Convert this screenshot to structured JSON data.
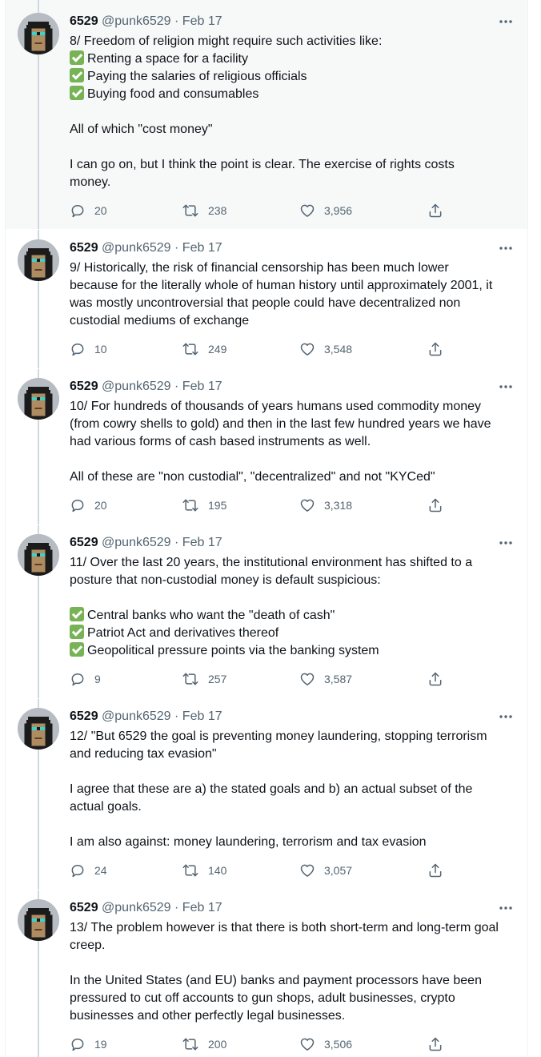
{
  "tweets": [
    {
      "name": "6529",
      "handle": "@punk6529",
      "separator": "·",
      "date": "Feb 17",
      "lines": [
        {
          "text": "8/ Freedom of religion might require such activities like:"
        },
        {
          "check": true,
          "text": "Renting a space for a facility"
        },
        {
          "check": true,
          "text": "Paying the salaries of religious officials"
        },
        {
          "check": true,
          "text": "Buying food and consumables"
        },
        {
          "gap": true
        },
        {
          "text": "All of which \"cost money\""
        },
        {
          "gap": true
        },
        {
          "text": "I can go on, but I think the point is clear.   The exercise of rights costs"
        },
        {
          "text": "money."
        }
      ],
      "replies": "20",
      "retweets": "238",
      "likes": "3,956"
    },
    {
      "name": "6529",
      "handle": "@punk6529",
      "separator": "·",
      "date": "Feb 17",
      "lines": [
        {
          "text": "9/ Historically, the risk of financial censorship has been much lower"
        },
        {
          "text": "because for the literally whole of human history until approximately 2001, it"
        },
        {
          "text": "was mostly uncontroversial that people could have decentralized non"
        },
        {
          "text": "custodial mediums of exchange"
        }
      ],
      "replies": "10",
      "retweets": "249",
      "likes": "3,548"
    },
    {
      "name": "6529",
      "handle": "@punk6529",
      "separator": "·",
      "date": "Feb 17",
      "lines": [
        {
          "text": "10/ For hundreds of thousands of years humans used commodity money"
        },
        {
          "text": "(from cowry shells to gold) and then in the last few hundred years we have"
        },
        {
          "text": "had various forms of cash based instruments as well."
        },
        {
          "gap": true
        },
        {
          "text": "All of these are \"non custodial\", \"decentralized\" and not \"KYCed\""
        }
      ],
      "replies": "20",
      "retweets": "195",
      "likes": "3,318"
    },
    {
      "name": "6529",
      "handle": "@punk6529",
      "separator": "·",
      "date": "Feb 17",
      "lines": [
        {
          "text": "11/ Over the last 20 years, the institutional environment has shifted to a"
        },
        {
          "text": "posture that non-custodial money is default suspicious:"
        },
        {
          "gap": true
        },
        {
          "check": true,
          "text": "Central banks who want the \"death of cash\""
        },
        {
          "check": true,
          "text": "Patriot Act and derivatives thereof"
        },
        {
          "check": true,
          "text": "Geopolitical pressure points via the banking system"
        }
      ],
      "replies": "9",
      "retweets": "257",
      "likes": "3,587"
    },
    {
      "name": "6529",
      "handle": "@punk6529",
      "separator": "·",
      "date": "Feb 17",
      "lines": [
        {
          "text": "12/ \"But 6529 the goal is preventing money laundering, stopping terrorism"
        },
        {
          "text": "and reducing tax evasion\""
        },
        {
          "gap": true
        },
        {
          "text": "I agree that these are a) the stated goals and b) an actual subset of the"
        },
        {
          "text": "actual goals."
        },
        {
          "gap": true
        },
        {
          "text": "I am also against: money laundering, terrorism and tax evasion"
        }
      ],
      "replies": "24",
      "retweets": "140",
      "likes": "3,057"
    },
    {
      "name": "6529",
      "handle": "@punk6529",
      "separator": "·",
      "date": "Feb 17",
      "lines": [
        {
          "text": "13/ The problem however is that there is both short-term and long-term goal"
        },
        {
          "text": "creep."
        },
        {
          "gap": true
        },
        {
          "text": "In the United States (and EU) banks and payment processors have been"
        },
        {
          "text": "pressured to cut off accounts to gun shops, adult businesses, crypto"
        },
        {
          "text": "businesses and other perfectly legal businesses."
        }
      ],
      "replies": "19",
      "retweets": "200",
      "likes": "3,506"
    }
  ],
  "icons": {
    "more": "more-icon",
    "reply": "reply-icon",
    "retweet": "retweet-icon",
    "like": "like-icon",
    "share": "share-icon"
  },
  "colors": {
    "text": "#0f1419",
    "secondary": "#536471",
    "check_green": "#77b255",
    "thread_line": "#cfd9de",
    "highlight_bg": "#f7f9f9"
  }
}
